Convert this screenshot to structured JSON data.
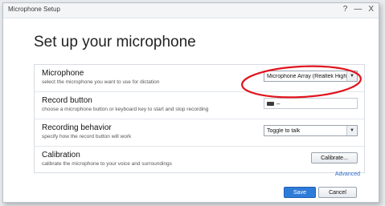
{
  "window": {
    "title": "Microphone Setup",
    "help_glyph": "?",
    "minimize_glyph": "—",
    "close_glyph": "X"
  },
  "page": {
    "heading": "Set up your microphone"
  },
  "settings": {
    "microphone": {
      "title": "Microphone",
      "description": "select the microphone you want to use for dictation",
      "selected": "Microphone Array (Realtek High"
    },
    "record_button": {
      "title": "Record button",
      "description": "choose a microphone button or keyboard key to start and stop recording",
      "value": "–"
    },
    "recording_behavior": {
      "title": "Recording behavior",
      "description": "specify how the record button will work",
      "selected": "Toggle to talk"
    },
    "calibration": {
      "title": "Calibration",
      "description": "calibrate the microphone to your voice and surroundings",
      "button_label": "Calibrate..."
    }
  },
  "footer": {
    "advanced_link": "Advanced",
    "save_label": "Save",
    "cancel_label": "Cancel"
  },
  "colors": {
    "accent_blue": "#2e7bd9",
    "link_blue": "#2a6ac8",
    "highlight_red": "#e0141e"
  }
}
